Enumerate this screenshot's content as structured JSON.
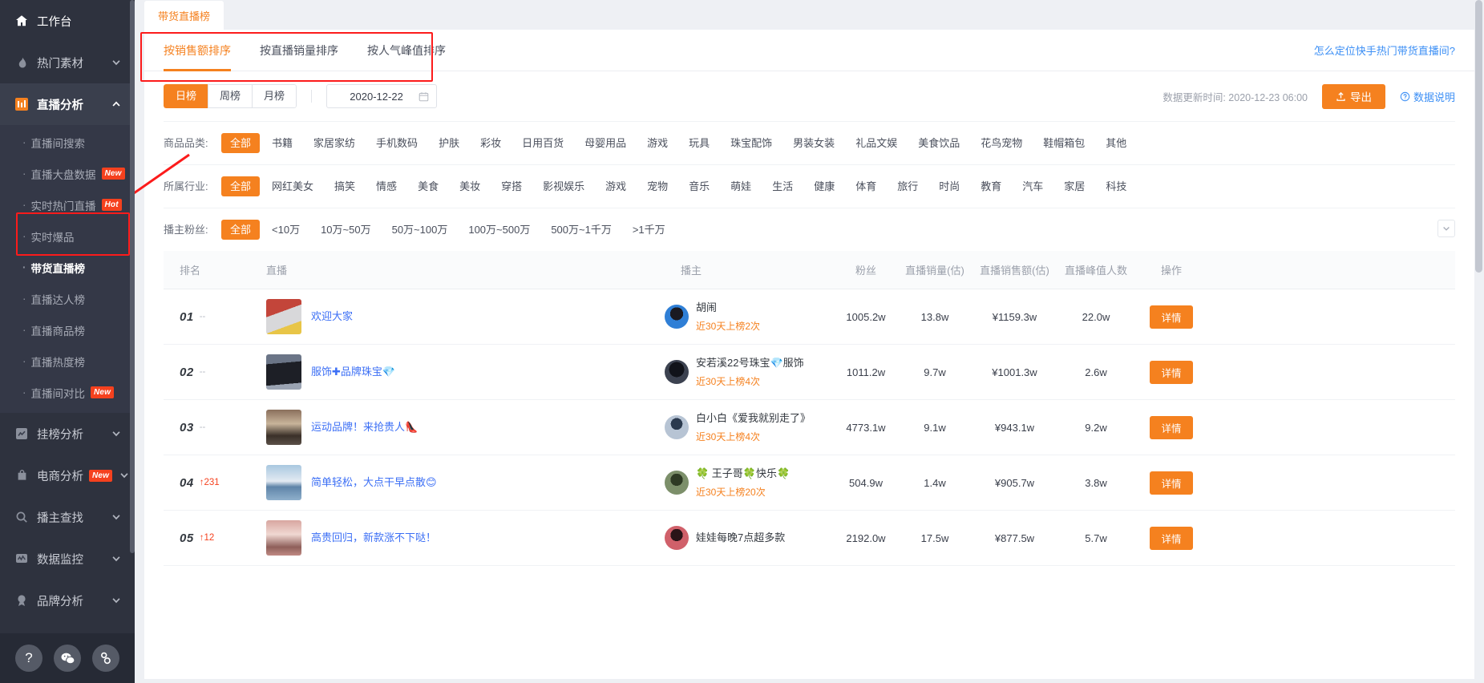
{
  "sidebar": {
    "groups": [
      {
        "label": "工作台",
        "icon": "home-icon",
        "expandable": false,
        "state": "top"
      },
      {
        "label": "热门素材",
        "icon": "fire-icon",
        "expandable": true,
        "state": "normal"
      },
      {
        "label": "直播分析",
        "icon": "bar-chart-icon",
        "expandable": true,
        "state": "active"
      }
    ],
    "sub_items": [
      {
        "label": "直播间搜索",
        "badge": ""
      },
      {
        "label": "直播大盘数据",
        "badge": "New"
      },
      {
        "label": "实时热门直播",
        "badge": "Hot"
      },
      {
        "label": "实时爆品",
        "badge": ""
      },
      {
        "label": "带货直播榜",
        "badge": "",
        "current": true
      },
      {
        "label": "直播达人榜",
        "badge": ""
      },
      {
        "label": "直播商品榜",
        "badge": ""
      },
      {
        "label": "直播热度榜",
        "badge": ""
      },
      {
        "label": "直播间对比",
        "badge": "New"
      }
    ],
    "lower_groups": [
      {
        "label": "挂榜分析",
        "icon": "trend-square-icon",
        "badge": ""
      },
      {
        "label": "电商分析",
        "icon": "bag-icon",
        "badge": "New"
      },
      {
        "label": "播主查找",
        "icon": "search-icon",
        "badge": ""
      },
      {
        "label": "数据监控",
        "icon": "monitor-icon",
        "badge": ""
      },
      {
        "label": "品牌分析",
        "icon": "medal-icon",
        "badge": ""
      }
    ],
    "footer_buttons": [
      {
        "icon": "question-icon",
        "glyph": "?"
      },
      {
        "icon": "wechat-icon",
        "glyph": ""
      },
      {
        "icon": "link-icon",
        "glyph": ""
      }
    ]
  },
  "header": {
    "tab_chip": "带货直播榜",
    "sort_tabs": [
      {
        "label": "按销售额排序",
        "active": true
      },
      {
        "label": "按直播销量排序",
        "active": false
      },
      {
        "label": "按人气峰值排序",
        "active": false
      }
    ],
    "howto_link": "怎么定位快手热门带货直播间?"
  },
  "controls": {
    "periods": [
      {
        "label": "日榜",
        "on": true
      },
      {
        "label": "周榜",
        "on": false
      },
      {
        "label": "月榜",
        "on": false
      }
    ],
    "date_value": "2020-12-22",
    "date_icon": "calendar-icon",
    "update_time": "数据更新时间: 2020-12-23 06:00",
    "export_label": "导出",
    "export_icon": "upload-icon",
    "data_help": "数据说明",
    "data_help_icon": "question-circle-icon"
  },
  "filters": [
    {
      "label": "商品品类:",
      "options": [
        "全部",
        "书籍",
        "家居家纺",
        "手机数码",
        "护肤",
        "彩妆",
        "日用百货",
        "母婴用品",
        "游戏",
        "玩具",
        "珠宝配饰",
        "男装女装",
        "礼品文娱",
        "美食饮品",
        "花鸟宠物",
        "鞋帽箱包",
        "其他"
      ],
      "selected": "全部",
      "collapse": false
    },
    {
      "label": "所属行业:",
      "options": [
        "全部",
        "网红美女",
        "搞笑",
        "情感",
        "美食",
        "美妆",
        "穿搭",
        "影视娱乐",
        "游戏",
        "宠物",
        "音乐",
        "萌娃",
        "生活",
        "健康",
        "体育",
        "旅行",
        "时尚",
        "教育",
        "汽车",
        "家居",
        "科技"
      ],
      "selected": "全部",
      "collapse": false
    },
    {
      "label": "播主粉丝:",
      "options": [
        "全部",
        "<10万",
        "10万~50万",
        "50万~100万",
        "100万~500万",
        "500万~1千万",
        ">1千万"
      ],
      "selected": "全部",
      "collapse": true,
      "collapse_icon": "chevron-down-icon"
    }
  ],
  "table": {
    "columns": [
      "排名",
      "直播",
      "播主",
      "粉丝",
      "直播销量(估)",
      "直播销售额(估)",
      "直播峰值人数",
      "操作"
    ],
    "action_label": "详情",
    "rows": [
      {
        "rank": "01",
        "delta": "--",
        "delta_up": false,
        "live_title": "欢迎大家",
        "host": "胡闹",
        "host_sub": "近30天上榜2次",
        "fans": "1005.2w",
        "volume": "13.8w",
        "amount": "¥1159.3w",
        "peak": "22.0w",
        "action": "详情",
        "thumb_colors": [
          "#c3453a",
          "#d8d8da",
          "#e8c547"
        ],
        "avatar_colors": [
          "#2f7fd6",
          "#1a1a22"
        ]
      },
      {
        "rank": "02",
        "delta": "--",
        "delta_up": false,
        "live_title": "服饰✚品牌珠宝💎",
        "host": "安若溪22号珠宝💎服饰",
        "host_sub": "近30天上榜4次",
        "fans": "1011.2w",
        "volume": "9.7w",
        "amount": "¥1001.3w",
        "peak": "2.6w",
        "action": "详情",
        "thumb_colors": [
          "#6b7587",
          "#1d1f26",
          "#9aa3b2"
        ],
        "avatar_colors": [
          "#3c4250",
          "#11131a"
        ]
      },
      {
        "rank": "03",
        "delta": "--",
        "delta_up": false,
        "live_title": "运动品牌！来抢贵人👠",
        "host": "白小白《爱我就别走了》",
        "host_sub": "近30天上榜4次",
        "fans": "4773.1w",
        "volume": "9.1w",
        "amount": "¥943.1w",
        "peak": "9.2w",
        "action": "详情",
        "thumb_colors": [
          "#8a6f5c",
          "#3a3028",
          "#c8b49a"
        ],
        "avatar_colors": [
          "#b7c4d4",
          "#2b3a4e"
        ]
      },
      {
        "rank": "04",
        "delta": "231",
        "delta_up": true,
        "live_title": "简单轻松，大点干早点散😊",
        "host": "🍀 王子哥🍀快乐🍀",
        "host_sub": "近30天上榜20次",
        "fans": "504.9w",
        "volume": "1.4w",
        "amount": "¥905.7w",
        "peak": "3.8w",
        "action": "详情",
        "thumb_colors": [
          "#a9c8e0",
          "#5f84a8",
          "#e3eaf2"
        ],
        "avatar_colors": [
          "#7c8f6a",
          "#2e3a24"
        ]
      },
      {
        "rank": "05",
        "delta": "12",
        "delta_up": true,
        "live_title": "高贵回归，新款涨不下哒！",
        "host": "娃娃每晚7点超多款",
        "host_sub": "",
        "fans": "2192.0w",
        "volume": "17.5w",
        "amount": "¥877.5w",
        "peak": "5.7w",
        "action": "详情",
        "thumb_colors": [
          "#d8a6a0",
          "#8e5f5a",
          "#f0d8d2"
        ],
        "avatar_colors": [
          "#d0606a",
          "#2a1418"
        ]
      }
    ]
  }
}
